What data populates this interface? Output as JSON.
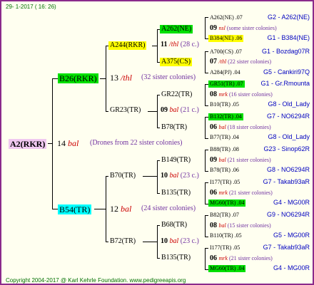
{
  "header": "29-  1-2017 ( 16: 26)",
  "footer": "Copyright 2004-2017 @ Karl Kehrle Foundation.   www.pedigreeapis.org",
  "root": {
    "label": "A2(RKR)",
    "gen_no": "14",
    "bal": "bal",
    "note": "(Drones from 22 sister colonies)"
  },
  "father": {
    "label": "B26(RKR)",
    "gen_no": "13",
    "mark": "/thl",
    "note": "(32 sister colonies)"
  },
  "mother": {
    "label": "B54(TR)",
    "gen_no": "12",
    "mark": "bal",
    "note": "(24 sister colonies)"
  },
  "ff": {
    "label": "A244(RKR)",
    "gen_no": "11",
    "mark": "/thl",
    "note": "(28 c.)"
  },
  "fm": {
    "label": "GR23(TR)",
    "gen_no": "09",
    "mark": "bal",
    "note": "(21 c.)"
  },
  "mf": {
    "label": "B70(TR)",
    "gen_no": "10",
    "mark": "bal",
    "note": "(23 c.)"
  },
  "mm": {
    "label": "B72(TR)",
    "gen_no": "10",
    "mark": "bal",
    "note": "(23 c.)"
  },
  "g3": {
    "a262": "A262(NE)",
    "a375": "A375(CS)",
    "gr22": "GR22(TR)",
    "b78": "B78(TR)",
    "b149": "B149(TR)",
    "b135a": "B135(TR)",
    "b68": "B68(TR)",
    "b135b": "B135(TR)"
  },
  "rows": [
    {
      "l": "A262(NE) .07",
      "r": "G2 - A262(NE)"
    },
    {
      "n": "09",
      "m": "nsl",
      "s": "(some sister colonies)"
    },
    {
      "l": "B384(NE) .06",
      "r": "G1 - B384(NE)"
    },
    {
      "l": "A700(CS) .07",
      "r": "G1 - Bozdag07R"
    },
    {
      "n": "07",
      "m": "/thl",
      "s": "(22 sister colonies)"
    },
    {
      "l": "A284(PJ) .04",
      "r": "G5 - Cankiri97Q"
    },
    {
      "l": "GR51(TR) .07",
      "r": "G1 - Gr.Rmounta"
    },
    {
      "n": "08",
      "m": "mrk",
      "s": "(16 sister colonies)"
    },
    {
      "l": "B10(TR) .05",
      "r": "G8 - Old_Lady"
    },
    {
      "l": "B132(TR) .04",
      "r": "G7 - NO6294R"
    },
    {
      "n": "06",
      "m": "bal",
      "s": "(18 sister colonies)"
    },
    {
      "l": "B77(TR) .04",
      "r": "G8 - Old_Lady"
    },
    {
      "l": "B88(TR) .08",
      "r": "G23 - Sinop62R"
    },
    {
      "n": "09",
      "m": "bal",
      "s": "(21 sister colonies)"
    },
    {
      "l": "B78(TR) .06",
      "r": "G8 - NO6294R"
    },
    {
      "l": "I177(TR) .05",
      "r": "G7 - Takab93aR"
    },
    {
      "n": "06",
      "m": "mrk",
      "s": "(21 sister colonies)"
    },
    {
      "l": "MG60(TR) .04",
      "r": "G4 - MG00R"
    },
    {
      "l": "B82(TR) .07",
      "r": "G9 - NO6294R"
    },
    {
      "n": "08",
      "m": "bal",
      "s": "(15 sister colonies)"
    },
    {
      "l": "B110(TR) .05",
      "r": "G5 - MG00R"
    },
    {
      "l": "I177(TR) .05",
      "r": "G7 - Takab93aR"
    },
    {
      "n": "06",
      "m": "mrk",
      "s": "(21 sister colonies)"
    },
    {
      "l": "MG60(TR) .04",
      "r": "G4 - MG00R"
    }
  ],
  "colors": {
    "green": "#00e000",
    "yellow": "#ffff00",
    "cyan": "#00ffff",
    "pink": "#f0c8f0"
  }
}
